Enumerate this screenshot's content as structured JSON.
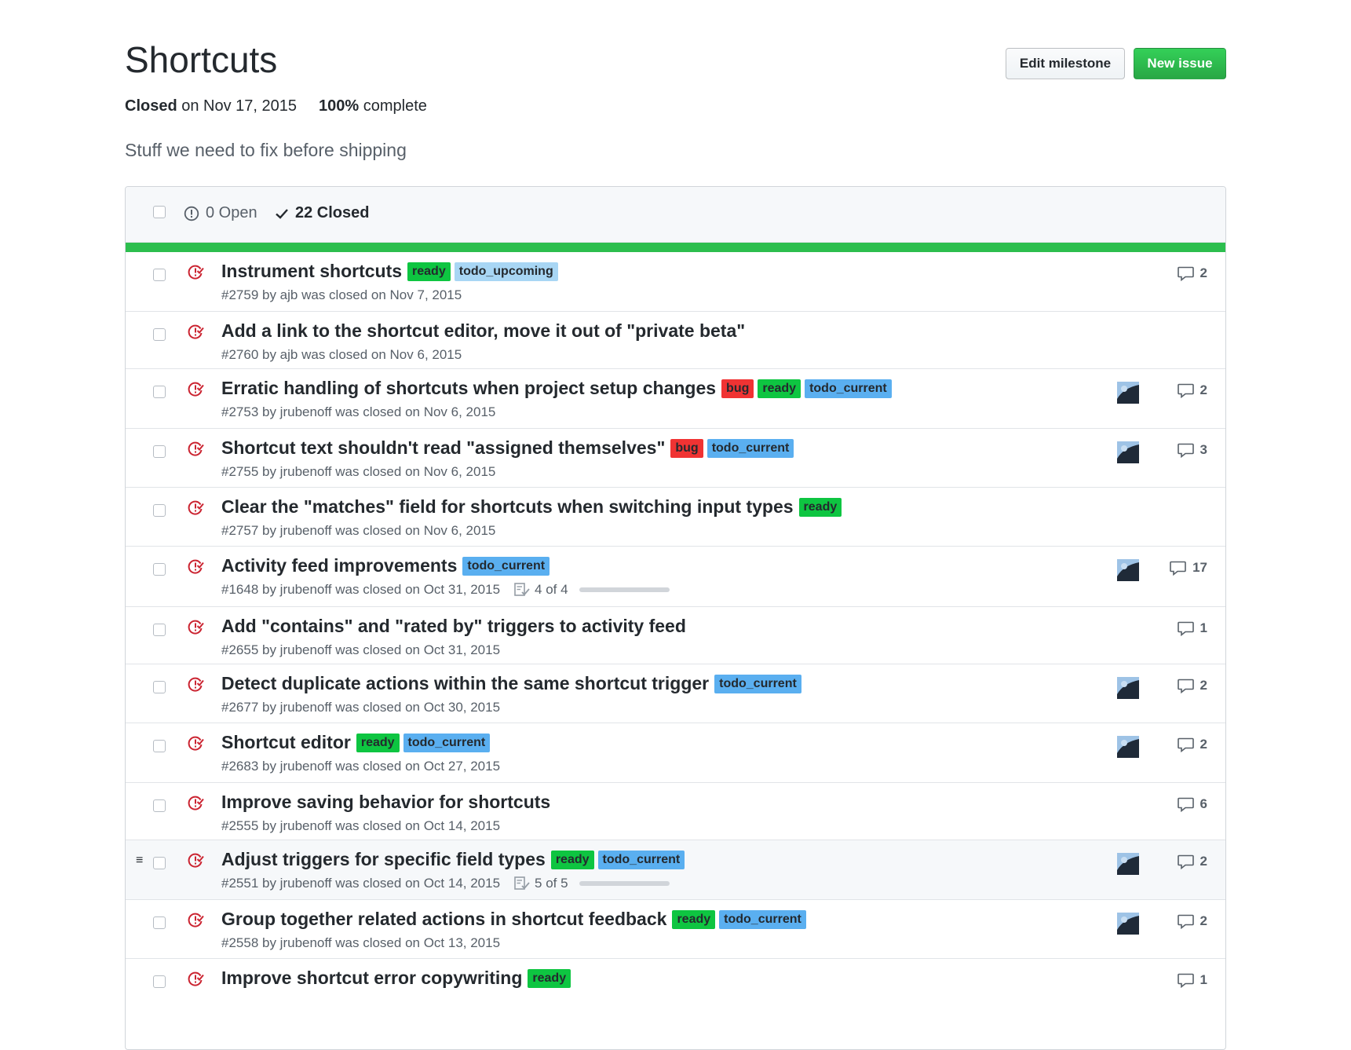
{
  "milestone": {
    "title": "Shortcuts",
    "state": "Closed",
    "closed_suffix": "on Nov 17, 2015",
    "percent": "100%",
    "percent_suffix": "complete",
    "description": "Stuff we need to fix before shipping"
  },
  "buttons": {
    "edit": "Edit milestone",
    "new_issue": "New issue"
  },
  "filters": {
    "open": "0 Open",
    "closed": "22 Closed"
  },
  "progress_fraction": 1.0,
  "colors": {
    "ready": "#0ec541",
    "todo_upcoming": "#a8d6f4",
    "todo_current": "#5aaff0",
    "bug": "#f03333",
    "closed_icon": "#cb2431",
    "green": "#2cbe4e"
  },
  "issues": [
    {
      "title": "Instrument shortcuts",
      "labels": [
        "ready",
        "todo_upcoming"
      ],
      "meta": "#2759 by ajb was closed on Nov 7, 2015",
      "avatar": false,
      "comments": "2"
    },
    {
      "title": "Add a link to the shortcut editor, move it out of \"private beta\"",
      "labels": [],
      "meta": "#2760 by ajb was closed on Nov 6, 2015",
      "avatar": false,
      "comments": ""
    },
    {
      "title": "Erratic handling of shortcuts when project setup changes",
      "labels": [
        "bug",
        "ready",
        "todo_current"
      ],
      "meta": "#2753 by jrubenoff was closed on Nov 6, 2015",
      "avatar": true,
      "comments": "2"
    },
    {
      "title": "Shortcut text shouldn't read \"assigned themselves\"",
      "labels": [
        "bug",
        "todo_current"
      ],
      "meta": "#2755 by jrubenoff was closed on Nov 6, 2015",
      "avatar": true,
      "comments": "3"
    },
    {
      "title": "Clear the \"matches\" field for shortcuts when switching input types",
      "labels": [
        "ready"
      ],
      "meta": "#2757 by jrubenoff was closed on Nov 6, 2015",
      "avatar": false,
      "comments": ""
    },
    {
      "title": "Activity feed improvements",
      "labels": [
        "todo_current"
      ],
      "meta": "#1648 by jrubenoff was closed on Oct 31, 2015",
      "tasks": "4 of 4",
      "avatar": true,
      "comments": "17"
    },
    {
      "title": "Add \"contains\" and \"rated by\" triggers to activity feed",
      "labels": [],
      "meta": "#2655 by jrubenoff was closed on Oct 31, 2015",
      "avatar": false,
      "comments": "1"
    },
    {
      "title": "Detect duplicate actions within the same shortcut trigger",
      "labels": [
        "todo_current"
      ],
      "meta": "#2677 by jrubenoff was closed on Oct 30, 2015",
      "avatar": true,
      "comments": "2"
    },
    {
      "title": "Shortcut editor",
      "labels": [
        "ready",
        "todo_current"
      ],
      "meta": "#2683 by jrubenoff was closed on Oct 27, 2015",
      "avatar": true,
      "comments": "2"
    },
    {
      "title": "Improve saving behavior for shortcuts",
      "labels": [],
      "meta": "#2555 by jrubenoff was closed on Oct 14, 2015",
      "avatar": false,
      "comments": "6"
    },
    {
      "title": "Adjust triggers for specific field types",
      "labels": [
        "ready",
        "todo_current"
      ],
      "meta": "#2551 by jrubenoff was closed on Oct 14, 2015",
      "tasks": "5 of 5",
      "avatar": true,
      "comments": "2",
      "hover": true
    },
    {
      "title": "Group together related actions in shortcut feedback",
      "labels": [
        "ready",
        "todo_current"
      ],
      "meta": "#2558 by jrubenoff was closed on Oct 13, 2015",
      "avatar": true,
      "comments": "2"
    },
    {
      "title": "Improve shortcut error copywriting",
      "labels": [
        "ready"
      ],
      "meta": "",
      "avatar": false,
      "comments": "1"
    }
  ]
}
